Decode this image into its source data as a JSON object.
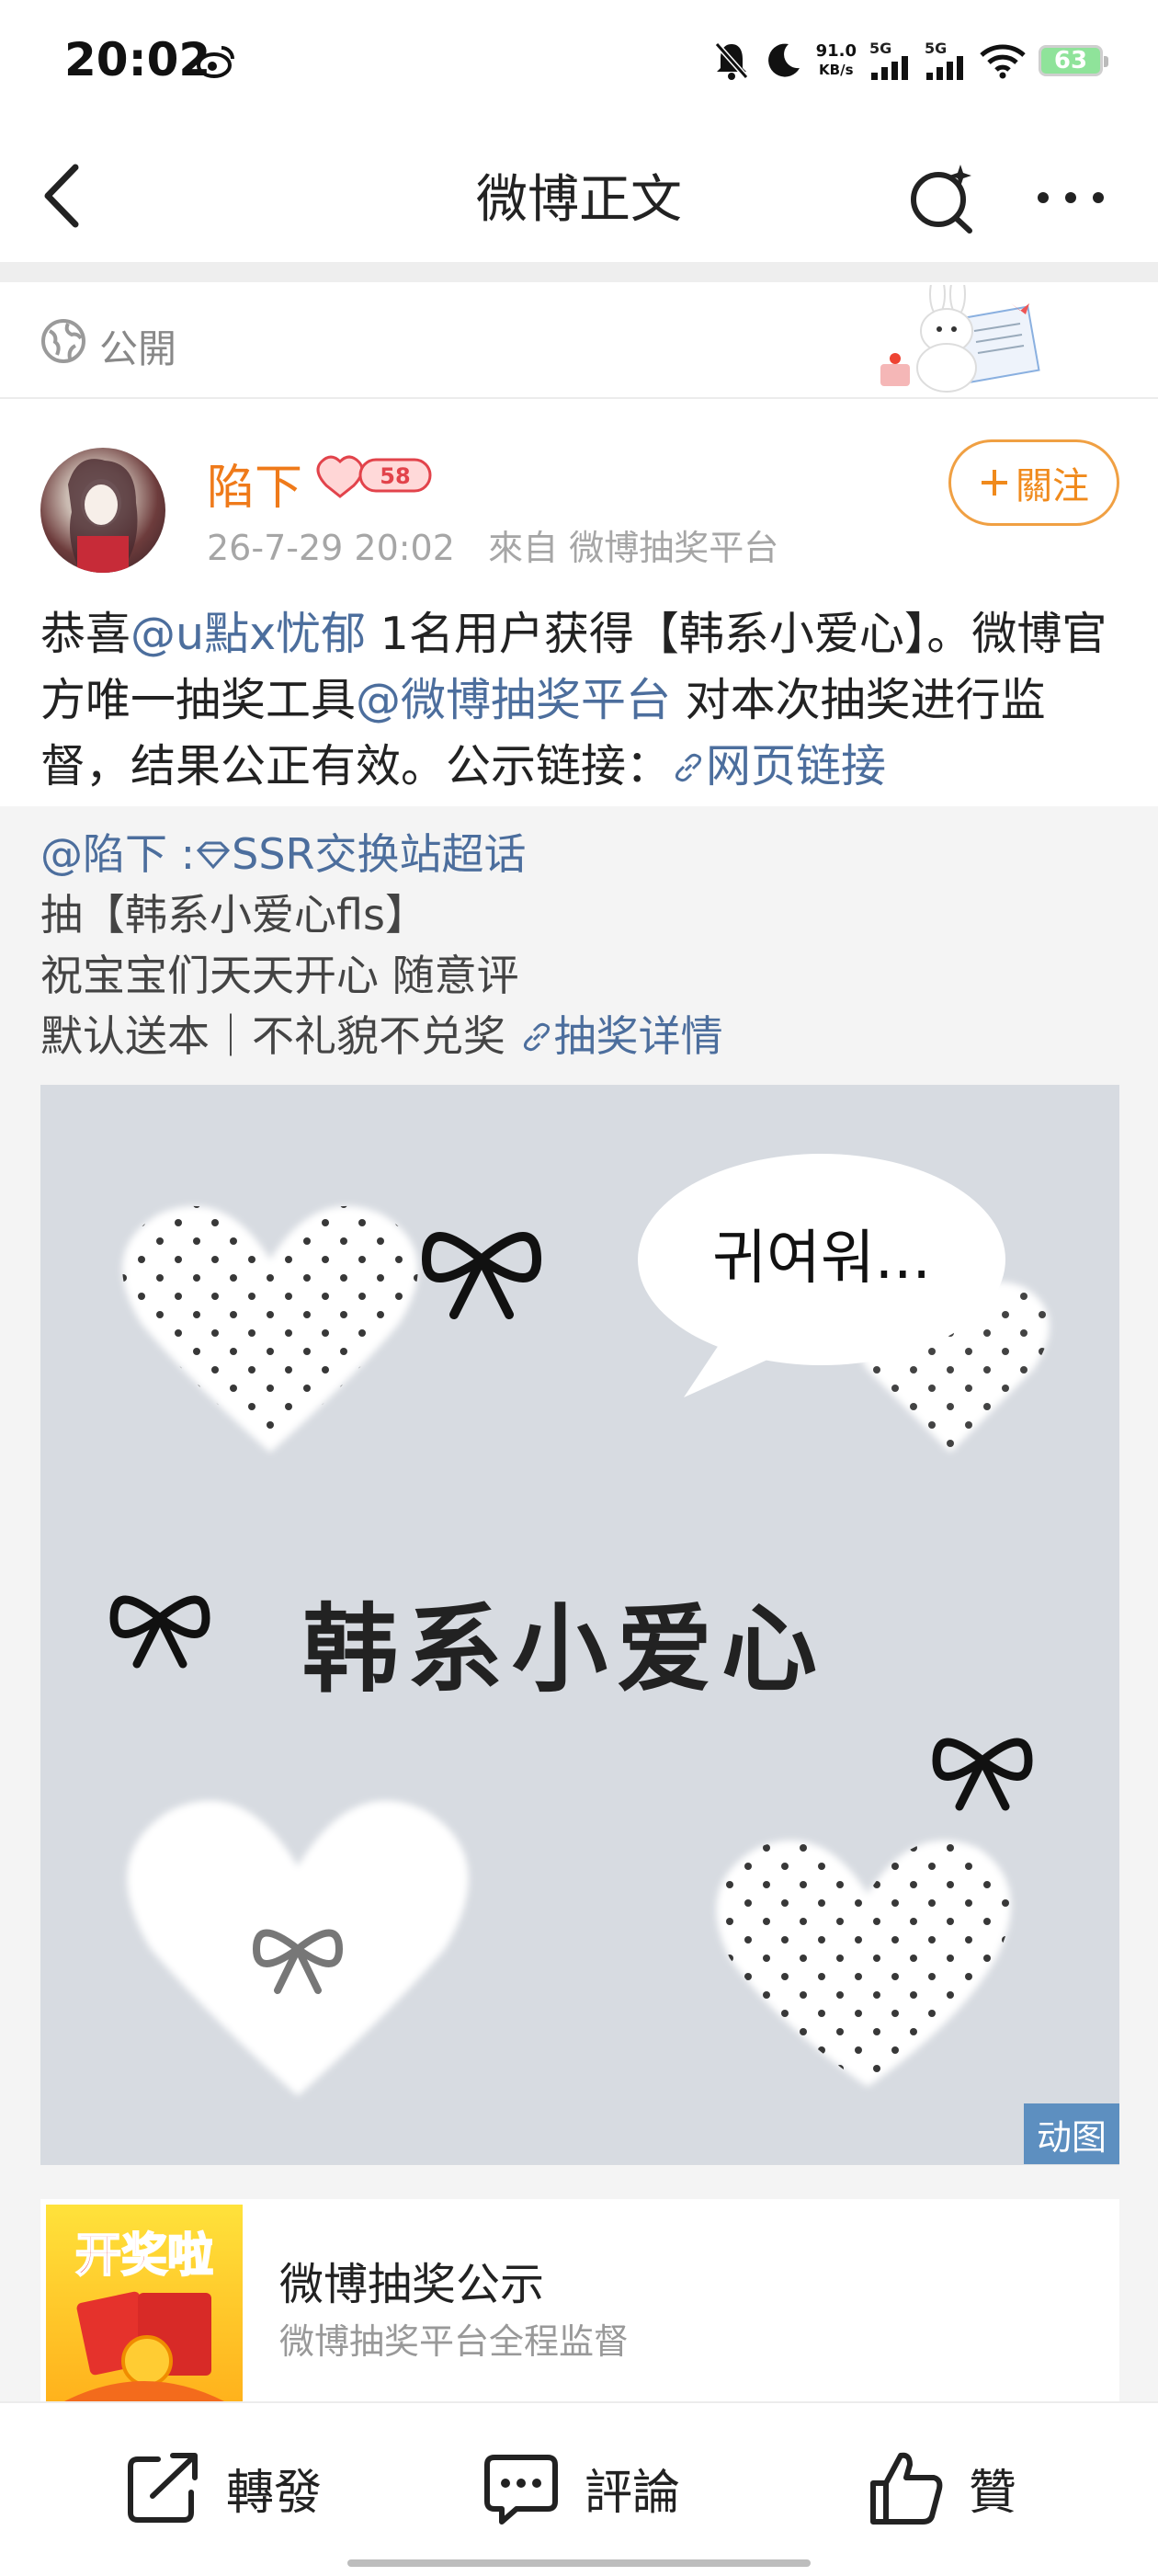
{
  "status_bar": {
    "time": "20:02",
    "net_speed_value": "91.0",
    "net_speed_unit": "KB/s",
    "sim1": "5G",
    "sim2": "5G",
    "battery": "63"
  },
  "nav": {
    "title": "微博正文"
  },
  "visibility": {
    "label": "公開"
  },
  "author": {
    "name": "陷下",
    "badge_text": "58",
    "meta": "26-7-29 20:02   來自 微博抽奖平台",
    "follow_label": "關注"
  },
  "post": {
    "t1": "恭喜",
    "mention1": "@u點x忧郁",
    "t2": " 1名用户获得【韩系小爱心】。微博官方唯一抽奖工具",
    "mention2": "@微博抽奖平台",
    "t3": " 对本次抽奖进行监督，结果公正有效。公示链接：",
    "link": "网页链接"
  },
  "repost": {
    "author": "@陷下",
    "sep": " :",
    "topic": "SSR交换站超话",
    "line2": "抽【韩系小爱心fls】",
    "line3": "祝宝宝们天天开心 随意评",
    "line4": "默认送本｜不礼貌不兑奖 ",
    "detail_link": "抽奖详情"
  },
  "image": {
    "bubble_text": "귀여워...",
    "center_text": "韩系小爱心",
    "gif_badge": "动图"
  },
  "card": {
    "thumb_text": "开奖啦",
    "title": "微博抽奖公示",
    "subtitle": "微博抽奖平台全程监督"
  },
  "toolbar": {
    "repost": "轉發",
    "comment": "評論",
    "like": "贊"
  }
}
